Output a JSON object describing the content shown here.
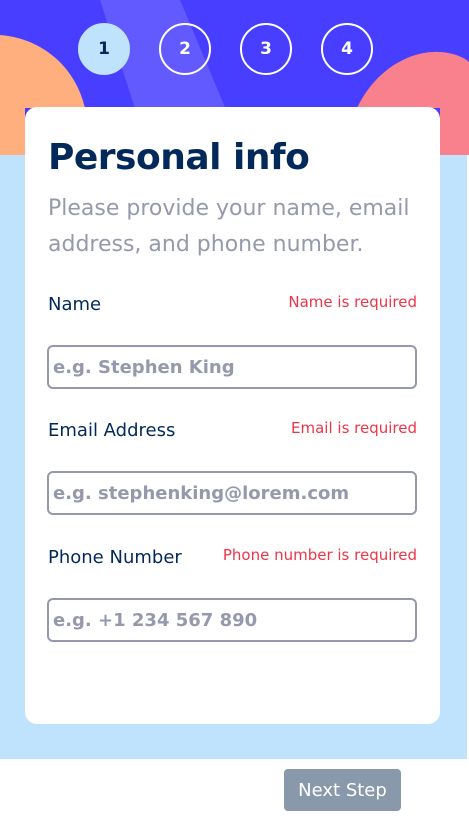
{
  "steps": [
    {
      "number": "1",
      "active": true
    },
    {
      "number": "2",
      "active": false
    },
    {
      "number": "3",
      "active": false
    },
    {
      "number": "4",
      "active": false
    }
  ],
  "card": {
    "title": "Personal info",
    "subtitle": "Please provide your name, email address, and phone number."
  },
  "fields": {
    "name": {
      "label": "Name",
      "error": "Name is required",
      "value": "",
      "placeholder": "e.g. Stephen King"
    },
    "email": {
      "label": "Email Address",
      "error": "Email is required",
      "value": "",
      "placeholder": "e.g. stephenking@lorem.com"
    },
    "phone": {
      "label": "Phone Number",
      "error": "Phone number is required",
      "value": "",
      "placeholder": "e.g. +1 234 567 890"
    }
  },
  "footer": {
    "next_label": "Next Step"
  },
  "colors": {
    "header_bg": "#483eff",
    "page_bg": "#bfe2fd",
    "title": "#02295a",
    "subtitle": "#9699ab",
    "error": "#ed3548",
    "button_disabled": "#8999ab"
  }
}
